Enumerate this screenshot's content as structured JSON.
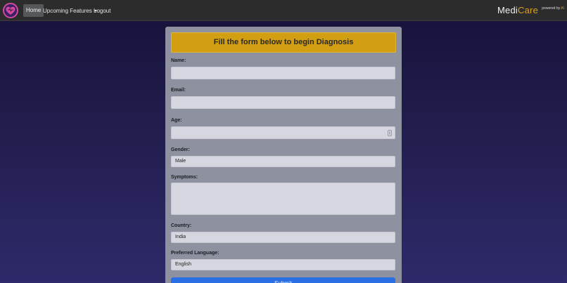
{
  "navbar": {
    "logo_icon": "heart-icon",
    "items": [
      {
        "label": "Home"
      },
      {
        "label": "Upcoming Features"
      },
      {
        "label": "Logout"
      }
    ],
    "brand": {
      "part1": "Medi",
      "part2": "Care",
      "sub": "powered by",
      "ai": "AI"
    }
  },
  "form": {
    "title": "Fill the form below to begin Diagnosis",
    "name_label": "Name:",
    "email_label": "Email:",
    "age_label": "Age:",
    "gender_label": "Gender:",
    "gender_value": "Male",
    "symptoms_label": "Symptoms:",
    "country_label": "Country:",
    "country_value": "India",
    "language_label": "Preferred Language:",
    "language_value": "English",
    "submit_label": "Submit"
  },
  "colors": {
    "accent": "#d29e12",
    "brand_accent": "#e0a11e",
    "submit": "#2a6fe4"
  }
}
